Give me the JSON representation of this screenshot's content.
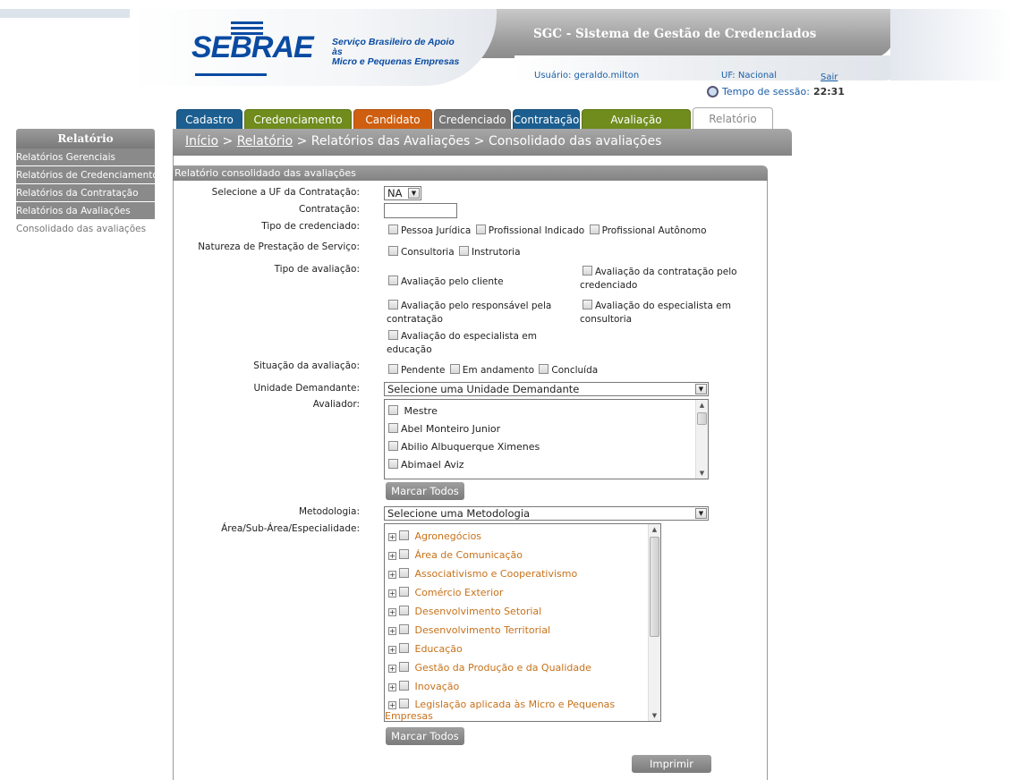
{
  "brand": {
    "name": "SEBRAE",
    "tagline_line1": "Serviço Brasileiro de Apoio às",
    "tagline_line2": "Micro e Pequenas Empresas"
  },
  "header": {
    "system_title": "SGC - Sistema de Gestão de Credenciados",
    "user": "Usuário: geraldo.milton",
    "uf": "UF: Nacional",
    "logout": "Sair",
    "session_label": "Tempo de sessão:",
    "session_time": "22:31"
  },
  "tabs": [
    "Cadastro",
    "Credenciamento",
    "Candidato",
    "Credenciado",
    "Contratação",
    "Avaliação",
    "Relatório"
  ],
  "breadcrumb": {
    "home": "Início",
    "sep": " > ",
    "report": "Relatório",
    "section": "Relatórios das Avaliações",
    "page": "Consolidado das avaliações"
  },
  "sidebar": {
    "title": "Relatório",
    "items": [
      "Relatórios Gerenciais",
      "Relatórios de Credenciamento",
      "Relatórios da Contratação",
      "Relatórios da Avaliações",
      "Consolidado das avaliações"
    ]
  },
  "form": {
    "title": "Relatório consolidado das avaliações",
    "uf_label": "Selecione a UF da Contratação:",
    "uf_value": "NA",
    "contratacao_label": "Contratação:",
    "contratacao_value": "",
    "tipo_cred_label": "Tipo de credenciado:",
    "tipo_cred": [
      "Pessoa Jurídica",
      "Profissional Indicado",
      "Profissional Autônomo"
    ],
    "natureza_label": "Natureza de Prestação de Serviço:",
    "natureza": [
      "Consultoria",
      "Instrutoria"
    ],
    "tipo_aval_label": "Tipo de avaliação:",
    "tipo_aval": [
      "Avaliação pelo cliente",
      "Avaliação da contratação pelo",
      "credenciado",
      "Avaliação pelo responsável pela",
      "contratação",
      "Avaliação do especialista em",
      "consultoria",
      "Avaliação do especialista em",
      "educação"
    ],
    "situacao_label": "Situação da avaliação:",
    "situacao": [
      "Pendente",
      "Em andamento",
      "Concluída"
    ],
    "unidade_label": "Unidade Demandante:",
    "unidade_value": "Selecione uma Unidade Demandante",
    "avaliador_label": "Avaliador:",
    "avaliadores": [
      "Mestre",
      "Abel Monteiro Junior",
      "Abilio Albuquerque Ximenes",
      "Abimael Aviz"
    ],
    "marcar_todos": "Marcar Todos",
    "metodologia_label": "Metodologia:",
    "metodologia_value": "Selecione uma Metodologia",
    "area_label": "Área/Sub-Área/Especialidade:",
    "areas": [
      "Agronegócios",
      "Área de Comunicação",
      "Associativismo e Cooperativismo",
      "Comércio Exterior",
      "Desenvolvimento Setorial",
      "Desenvolvimento Territorial",
      "Educação",
      "Gestão da Produção e da Qualidade",
      "Inovação",
      "Legislação aplicada às Micro e Pequenas",
      "Empresas"
    ],
    "imprimir": "Imprimir"
  },
  "colors": {
    "blue": "#0a4ba2",
    "green": "#6f8c1d",
    "orange": "#cf5f10",
    "grey": "#8a8a8a"
  }
}
